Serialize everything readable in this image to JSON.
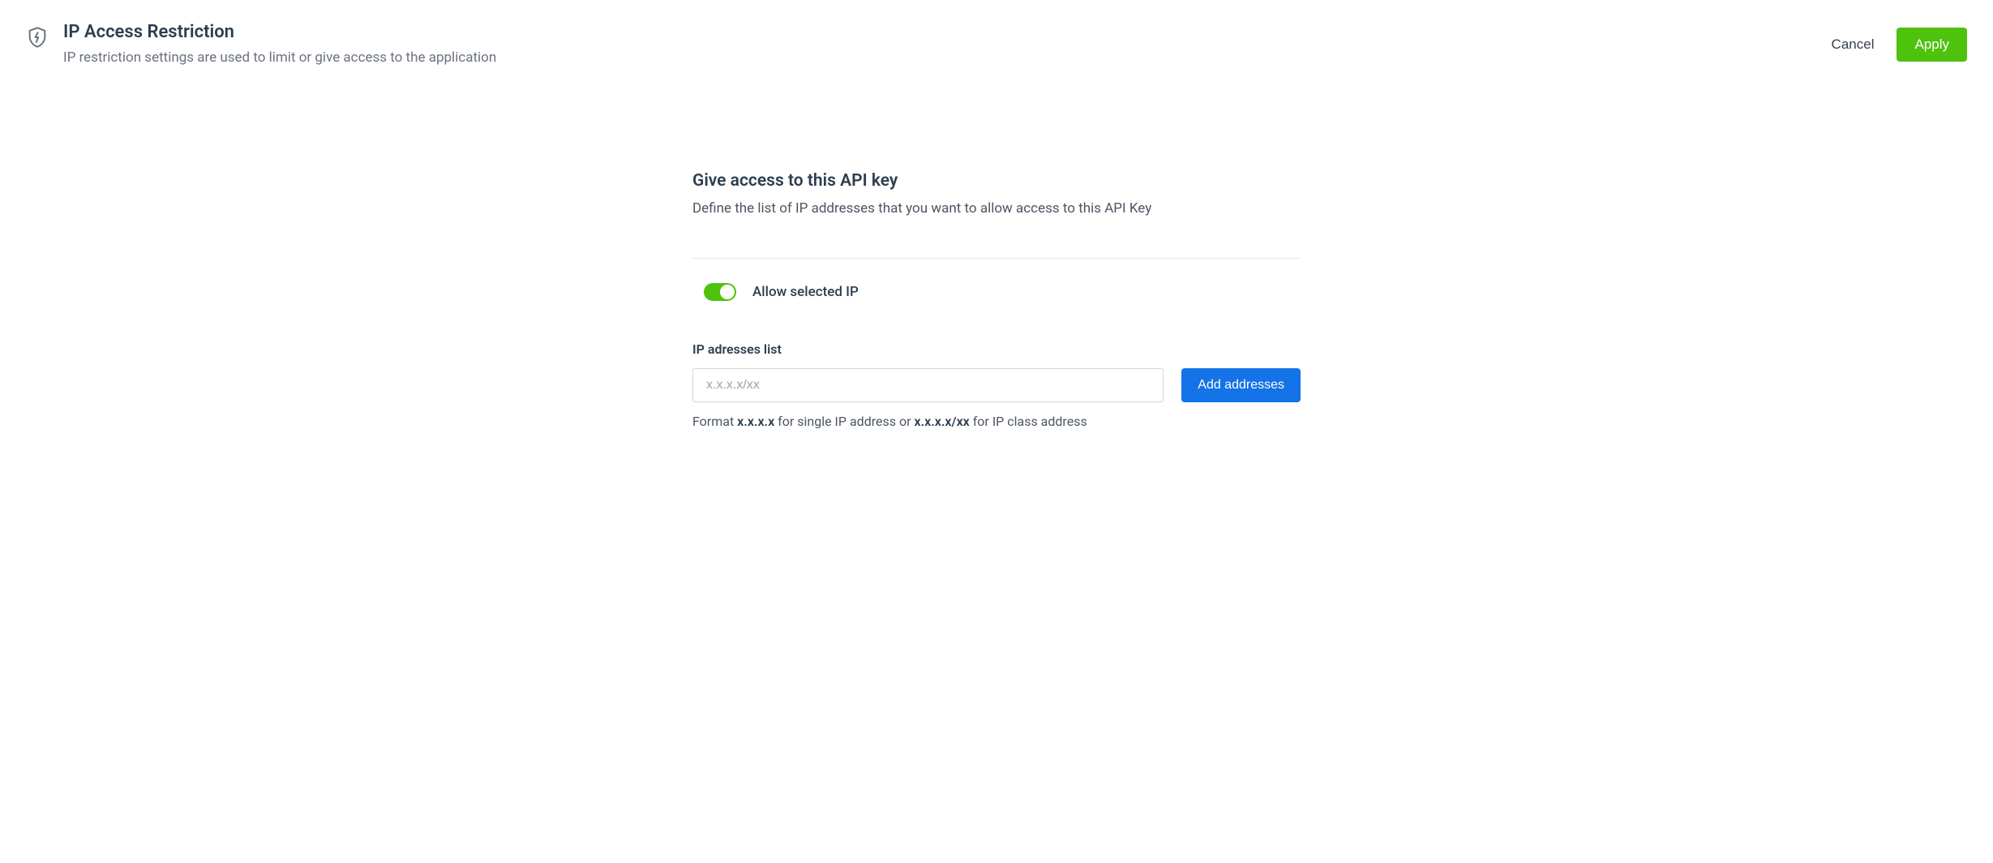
{
  "header": {
    "title": "IP Access Restriction",
    "subtitle": "IP restriction settings are used to limit or give access to the application",
    "cancel_label": "Cancel",
    "apply_label": "Apply"
  },
  "section": {
    "title": "Give access to this API key",
    "subtitle": "Define the list of IP addresses that you want to allow access to this API Key"
  },
  "toggle": {
    "label": "Allow selected IP",
    "on": true
  },
  "ip_list": {
    "label": "IP adresses list",
    "placeholder": "x.x.x.x/xx",
    "value": "",
    "add_label": "Add addresses",
    "hint_prefix": "Format ",
    "hint_bold1": "x.x.x.x",
    "hint_mid": " for single IP address or ",
    "hint_bold2": "x.x.x.x/xx",
    "hint_suffix": " for IP class address"
  }
}
